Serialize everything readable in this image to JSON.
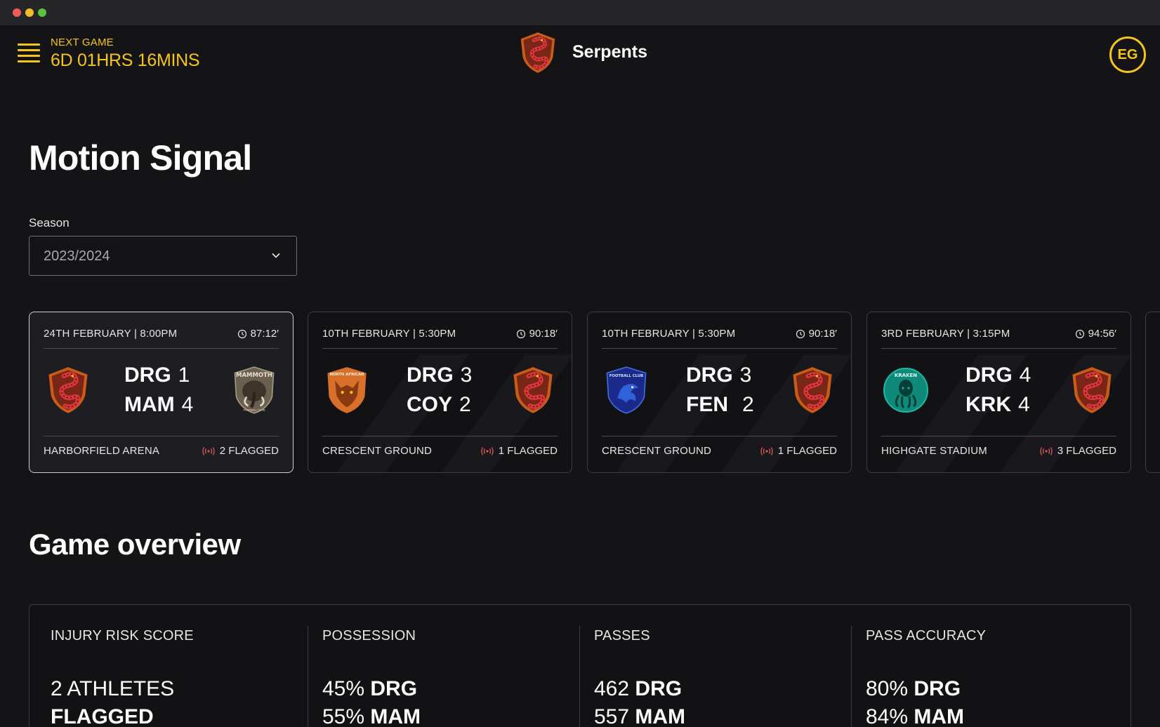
{
  "window": {
    "controls": [
      "close",
      "minimize",
      "maximize"
    ]
  },
  "header": {
    "next_game_label": "NEXT GAME",
    "next_game_countdown": "6D 01HRS 16MINS",
    "team_name": "Serpents",
    "avatar_initials": "EG",
    "accent_color": "#f5c518"
  },
  "page": {
    "title": "Motion Signal"
  },
  "season": {
    "label": "Season",
    "value": "2023/2024"
  },
  "matches": [
    {
      "date": "24TH FEBRUARY | 8:00PM",
      "duration": "87:12′",
      "home": {
        "abbr": "DRG",
        "score": "1"
      },
      "away": {
        "abbr": "MAM",
        "score": "4"
      },
      "left_crest": "serpents-crest",
      "right_crest": "mammoth-crest",
      "venue": "HARBORFIELD ARENA",
      "flagged": "2 FLAGGED",
      "selected": true
    },
    {
      "date": "10TH FEBRUARY | 5:30PM",
      "duration": "90:18′",
      "home": {
        "abbr": "DRG",
        "score": "3"
      },
      "away": {
        "abbr": "COY",
        "score": "2"
      },
      "left_crest": "coyote-crest",
      "right_crest": "serpents-crest",
      "venue": "CRESCENT GROUND",
      "flagged": "1 FLAGGED",
      "selected": false
    },
    {
      "date": "10TH FEBRUARY | 5:30PM",
      "duration": "90:18′",
      "home": {
        "abbr": "DRG",
        "score": "3"
      },
      "away": {
        "abbr": "FEN",
        "score": "2"
      },
      "left_crest": "griffin-crest",
      "right_crest": "serpents-crest",
      "venue": "CRESCENT GROUND",
      "flagged": "1 FLAGGED",
      "selected": false
    },
    {
      "date": "3RD FEBRUARY | 3:15PM",
      "duration": "94:56′",
      "home": {
        "abbr": "DRG",
        "score": "4"
      },
      "away": {
        "abbr": "KRK",
        "score": "4"
      },
      "left_crest": "kraken-crest",
      "right_crest": "serpents-crest",
      "venue": "HIGHGATE STADIUM",
      "flagged": "3 FLAGGED",
      "selected": false
    }
  ],
  "crest_text": {
    "mammoth": "MAMMOTH",
    "mammoth_sub": "FOOTBALL CLUB",
    "coyote": "NORTH AFRICAN",
    "griffin": "FOOTBALL CLUB",
    "kraken": "KRAKEN"
  },
  "overview": {
    "title": "Game overview",
    "stats": [
      {
        "label": "INJURY RISK SCORE",
        "line1_value": "2 ATHLETES",
        "line1_team": "",
        "line2_value": "",
        "line2_team": "FLAGGED"
      },
      {
        "label": "POSSESSION",
        "line1_value": "45%",
        "line1_team": "DRG",
        "line2_value": "55%",
        "line2_team": "MAM"
      },
      {
        "label": "PASSES",
        "line1_value": "462",
        "line1_team": "DRG",
        "line2_value": "557",
        "line2_team": "MAM"
      },
      {
        "label": "PASS ACCURACY",
        "line1_value": "80%",
        "line1_team": "DRG",
        "line2_value": "84%",
        "line2_team": "MAM"
      }
    ]
  },
  "colors": {
    "background": "#141316",
    "accent": "#f5c518",
    "flag": "#e05a5a"
  }
}
